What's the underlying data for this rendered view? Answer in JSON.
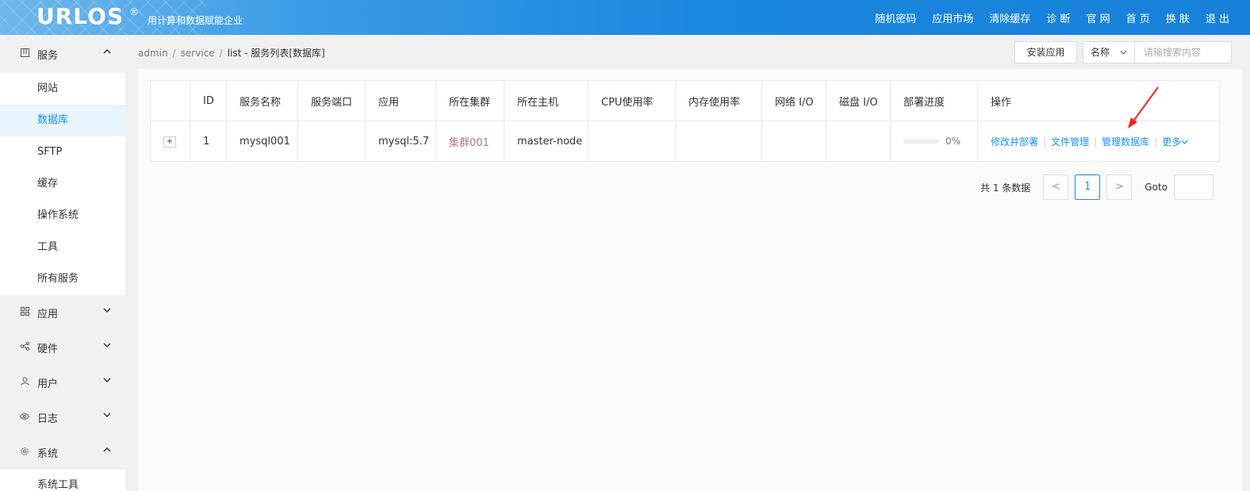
{
  "header": {
    "logo": "URLOS",
    "logo_mark": "®",
    "slogan": "用计算和数据赋能企业",
    "nav": [
      "随机密码",
      "应用市场",
      "清除缓存",
      "诊 断",
      "官 网",
      "首 页",
      "换 肤",
      "退 出"
    ]
  },
  "sidebar": {
    "groups": [
      {
        "label": "服务",
        "icon": "grid-icon",
        "expanded": true,
        "items": [
          "网站",
          "数据库",
          "SFTP",
          "缓存",
          "操作系统",
          "工具",
          "所有服务"
        ],
        "active_item": "数据库"
      },
      {
        "label": "应用",
        "icon": "apps-icon",
        "expanded": false
      },
      {
        "label": "硬件",
        "icon": "share-icon",
        "expanded": false
      },
      {
        "label": "用户",
        "icon": "user-icon",
        "expanded": false
      },
      {
        "label": "日志",
        "icon": "eye-icon",
        "expanded": false
      },
      {
        "label": "系统",
        "icon": "gear-icon",
        "expanded": true,
        "items": [
          "系统工具"
        ]
      }
    ]
  },
  "breadcrumb": {
    "parts": [
      "admin",
      "service",
      "list"
    ],
    "title": "服务列表[数据库]"
  },
  "toolbar": {
    "install_label": "安装应用",
    "search_field": "名称",
    "search_placeholder": "请输搜索内容"
  },
  "table": {
    "columns": [
      "",
      "ID",
      "服务名称",
      "服务端口",
      "应用",
      "所在集群",
      "所在主机",
      "CPU使用率",
      "内存使用率",
      "网络 I/O",
      "磁盘 I/O",
      "部署进度",
      "操作"
    ],
    "rows": [
      {
        "expand": "+",
        "id": "1",
        "name": "mysql001",
        "port": "",
        "app": "mysql:5.7",
        "cluster": "集群001",
        "host": "master-node",
        "cpu": "",
        "mem": "",
        "net": "",
        "disk": "",
        "progress": 0,
        "progress_label": "0%",
        "ops": [
          "修改并部署",
          "文件管理",
          "管理数据库",
          "更多"
        ]
      }
    ]
  },
  "pagination": {
    "total_label": "共 1 条数据",
    "prev": "<",
    "current": "1",
    "next": ">",
    "goto_label": "Goto"
  },
  "colors": {
    "accent": "#1890ff",
    "annotation": "#ff1f1f",
    "header": "#1b88e0"
  }
}
